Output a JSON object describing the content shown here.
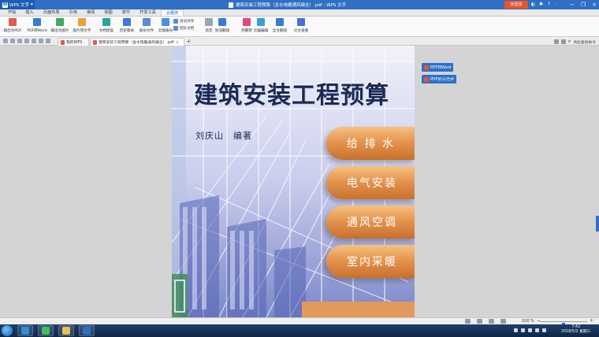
{
  "titlebar": {
    "app_name": "WPS 文字",
    "window_title": "建筑安装工程预算（含水电暖通风编全）.pdf - WPS 文字",
    "login_label": "未登录",
    "icons": [
      "skin-icon",
      "settings-icon",
      "help-icon",
      "chevron-icon"
    ],
    "window_controls": [
      "minimize",
      "restore",
      "close"
    ]
  },
  "menubar": {
    "tabs": [
      "开始",
      "插入",
      "页面布局",
      "引用",
      "审阅",
      "视图",
      "章节",
      "开发工具",
      "云服务"
    ],
    "active_index": 8
  },
  "ribbon": {
    "buttons": [
      {
        "label": "输出为PDF",
        "color": "#e25b4b"
      },
      {
        "label": "PDF转Word",
        "color": "#3a7bd5"
      },
      {
        "label": "输出为图片",
        "color": "#44a866"
      },
      {
        "label": "图片转文字",
        "color": "#e9a13a"
      },
      {
        "label": "文档修复",
        "color": "#26a69a"
      },
      {
        "label": "历史版本",
        "color": "#3a7bd5"
      },
      {
        "label": "备份文件",
        "color": "#5b8ad6"
      },
      {
        "label": "云端备份",
        "color": "#4a90e2"
      },
      {
        "label": "语音",
        "color": "#9aa6b5"
      },
      {
        "label": "划词翻译",
        "color": "#3a7bd5"
      },
      {
        "label": "简繁转",
        "color": "#e2467a"
      },
      {
        "label": "云编编辑",
        "color": "#3aa0d5"
      },
      {
        "label": "全文翻译",
        "color": "#3a7bd5"
      },
      {
        "label": "论文查重",
        "color": "#4a6fd5"
      }
    ],
    "small_buttons": [
      {
        "label": "会员共享",
        "color": "#5b8ad6"
      },
      {
        "label": "团队文档",
        "color": "#5b8ad6"
      }
    ]
  },
  "docbar": {
    "tabs": [
      {
        "label": "我的WPS",
        "color": "#e25b4b"
      },
      {
        "label": "建筑安装工程预算（含水电暖通风编全）.pdf",
        "color": "#e25b4b"
      }
    ],
    "close_glyph": "×",
    "plus_glyph": "+",
    "right_label": "点此查找命令"
  },
  "document": {
    "title": "建筑安装工程预算",
    "author": "刘庆山　编著",
    "pills": [
      "给 排 水",
      "电气安装",
      "通风空调",
      "室内采暖"
    ]
  },
  "side_buttons": [
    "PDF转Word",
    "PDF拆分/合并"
  ],
  "statusbar": {
    "zoom": "100 %",
    "zoom_minus": "−",
    "zoom_plus": "+",
    "zoom_level": 0.5
  },
  "taskbar": {
    "apps": [
      {
        "name": "ie-icon",
        "color": "#2f8ee0"
      },
      {
        "name": "browser-icon",
        "color": "#3fbf5a"
      },
      {
        "name": "folder-icon",
        "color": "#e8c04a"
      },
      {
        "name": "wps-icon",
        "color": "#2d70c8"
      }
    ],
    "time": "7:42",
    "date": "2018/5/2 星期三"
  }
}
